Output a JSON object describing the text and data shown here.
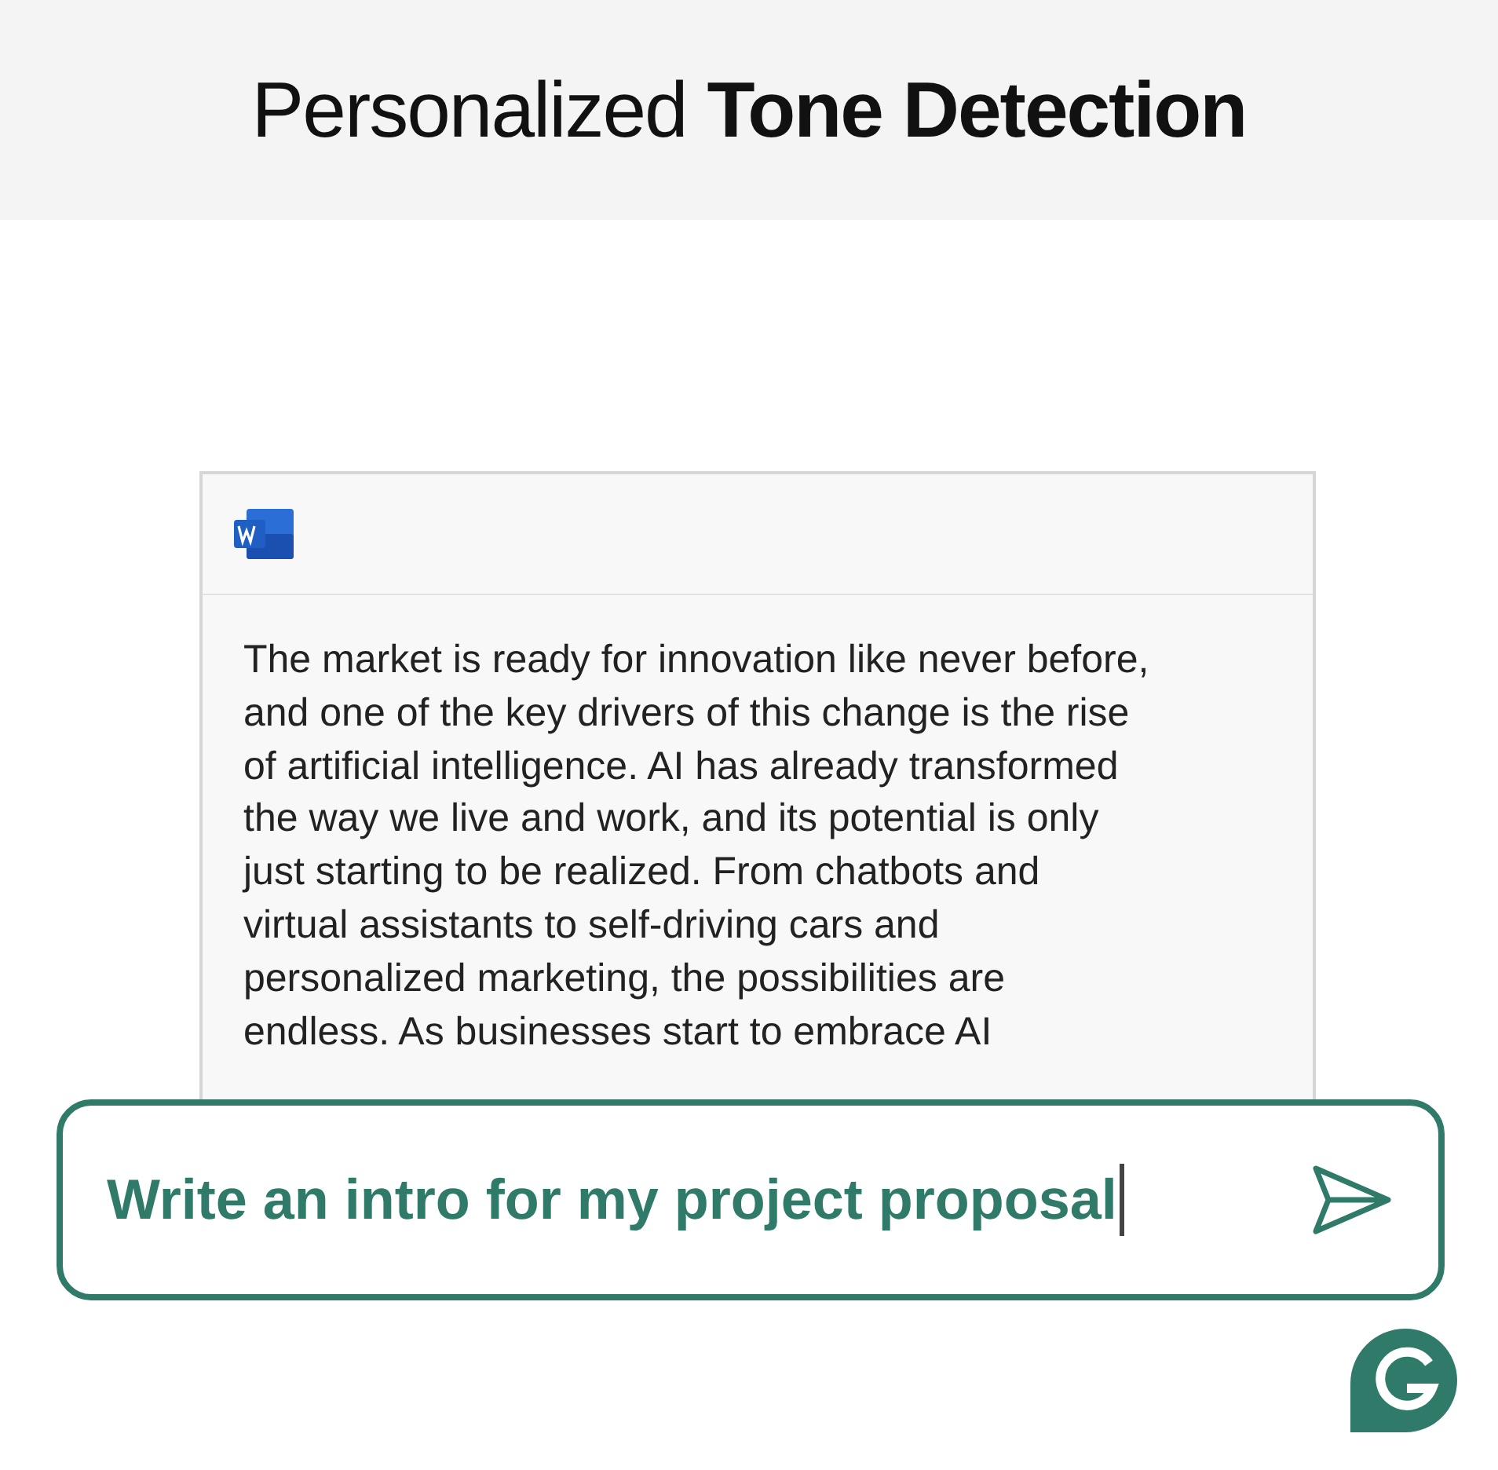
{
  "header": {
    "title": "Personalized **Tone Detection**"
  },
  "document": {
    "lines": [
      "The market is ready for innovation like never before,",
      "and one of the key drivers of this change is the rise",
      "of artificial intelligence. AI has already transformed",
      "the way we live and work, and its potential is only",
      "just starting to be realized. From chatbots and",
      "virtual assistants to self-driving cars and",
      "personalized marketing, the possibilities are",
      "endless. As businesses start to embrace AI"
    ]
  },
  "prompt": {
    "value": "Write an intro for my project proposal"
  }
}
